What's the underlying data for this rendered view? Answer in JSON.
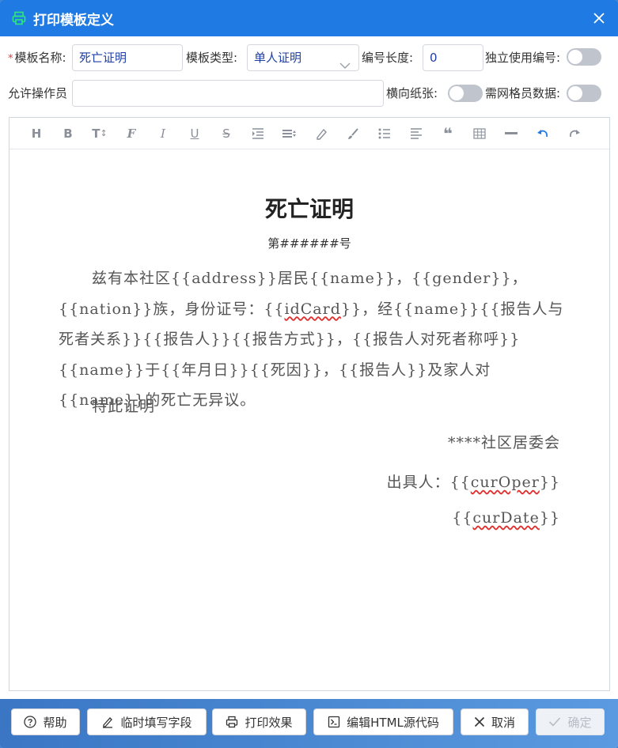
{
  "dialog": {
    "title": "打印模板定义",
    "icon": "printer-icon",
    "close_icon": "close-icon"
  },
  "form": {
    "template_name_label": "模板名称:",
    "template_name_value": "死亡证明",
    "template_type_label": "模板类型:",
    "template_type_value": "单人证明",
    "number_length_label": "编号长度:",
    "number_length_value": "0",
    "independent_number_label": "独立使用编号:",
    "independent_number_on": false,
    "allowed_operators_label": "允许操作员",
    "allowed_operators_value": "",
    "landscape_label": "横向纸张:",
    "landscape_on": false,
    "grid_data_label": "需网格员数据:",
    "grid_data_on": false
  },
  "toolbar": {
    "icons": [
      "heading-icon",
      "bold-icon",
      "font-size-icon",
      "font-family-icon",
      "italic-icon",
      "underline-icon",
      "strikethrough-icon",
      "indent-icon",
      "line-height-icon",
      "font-color-icon",
      "background-color-icon",
      "list-icon",
      "align-icon",
      "quote-icon",
      "table-icon",
      "horizontal-rule-icon",
      "undo-icon",
      "redo-icon"
    ]
  },
  "document": {
    "title": "死亡证明",
    "number": "第######号",
    "p1": "兹有本社区",
    "t_address": "{{address}}",
    "p2": "居民",
    "t_name1": "{{name}}",
    "p3": "，",
    "t_gender": "{{gender}}",
    "p4": "，",
    "t_nation": "{{nation}}",
    "p5": "族，身份证号：",
    "t_idcard_open": "{{",
    "t_idcard": "idCard",
    "t_idcard_close": "}}",
    "p6": "，经",
    "t_name2": "{{name}}",
    "t_relation": "{{报告人与死者关系}}",
    "t_reporter": "{{报告人}}",
    "t_method": "{{报告方式}}",
    "p7": "，",
    "t_title": "{{报告人对死者称呼}}",
    "t_name3": "{{name}}",
    "p8": "于",
    "t_date": "{{年月日}}",
    "t_cause": "{{死因}}",
    "p9": "，",
    "t_reporter2": "{{报告人}}",
    "p10": "及家人对",
    "t_name4": "{{name}}",
    "p11": "的死亡无异议。",
    "line2": "特此证明",
    "committee": "****社区居委会",
    "issuer_label": "出具人：",
    "issuer_open": "{{",
    "issuer_var": "curOper",
    "issuer_close": "}}",
    "date_open": "{{",
    "date_var": "curDate",
    "date_close": "}}"
  },
  "footer": {
    "help": "帮助",
    "temp_fields": "临时填写字段",
    "print_preview": "打印效果",
    "edit_html": "编辑HTML源代码",
    "cancel": "取消",
    "confirm": "确定"
  },
  "colors": {
    "titlebar": "#1f7be3",
    "required": "#e4393c",
    "input_text": "#1f3fa3"
  }
}
